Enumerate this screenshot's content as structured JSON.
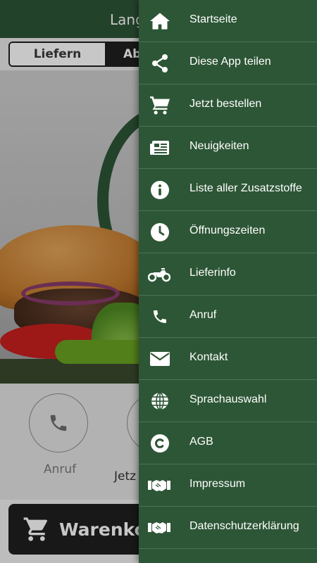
{
  "header": {
    "title": "Lang"
  },
  "mode_toggle": {
    "deliver_label": "Liefern",
    "pickup_label": "Abho"
  },
  "actions": {
    "call_label": "Anruf",
    "order_label": "Jetz"
  },
  "cart": {
    "label": "Warenkorb"
  },
  "menu": {
    "items": [
      {
        "label": "Startseite",
        "icon": "home-icon"
      },
      {
        "label": "Diese App teilen",
        "icon": "share-icon"
      },
      {
        "label": "Jetzt bestellen",
        "icon": "cart-icon"
      },
      {
        "label": "Neuigkeiten",
        "icon": "newspaper-icon"
      },
      {
        "label": "Liste aller Zusatzstoffe",
        "icon": "info-icon"
      },
      {
        "label": "Öffnungszeiten",
        "icon": "clock-icon"
      },
      {
        "label": "Lieferinfo",
        "icon": "motorcycle-icon"
      },
      {
        "label": "Anruf",
        "icon": "phone-icon"
      },
      {
        "label": "Kontakt",
        "icon": "envelope-icon"
      },
      {
        "label": "Sprachauswahl",
        "icon": "globe-icon"
      },
      {
        "label": "AGB",
        "icon": "copyright-icon"
      },
      {
        "label": "Impressum",
        "icon": "handshake-icon"
      },
      {
        "label": "Datenschutzerklärung",
        "icon": "handshake-icon"
      }
    ]
  },
  "colors": {
    "brand_green": "#2d5636",
    "accent_green": "#6aa320",
    "dark": "#1f1f1f"
  }
}
